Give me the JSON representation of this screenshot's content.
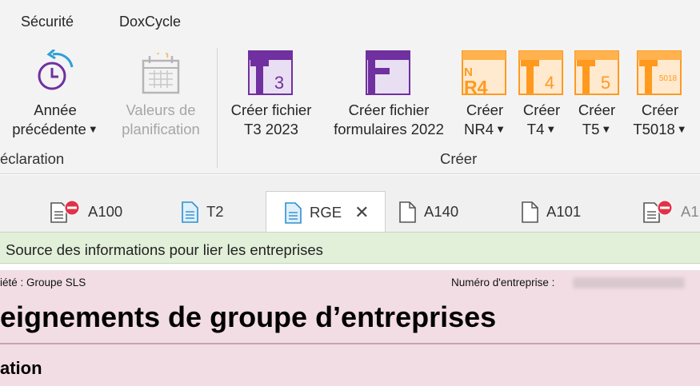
{
  "menu": {
    "tabs": [
      "Sécurité",
      "DoxCycle"
    ]
  },
  "ribbon": {
    "annee": {
      "line1": "Année",
      "line2": "précédente"
    },
    "valeurs": {
      "line1": "Valeurs de",
      "line2": "planification"
    },
    "t3": {
      "icon_text": "T3",
      "line1": "Créer fichier",
      "line2": "T3 2023"
    },
    "form": {
      "icon_text": "F",
      "line1": "Créer fichier",
      "line2": "formulaires 2022"
    },
    "nr4": {
      "icon_text": "NR4",
      "line1": "Créer",
      "line2": "NR4"
    },
    "t4": {
      "icon_text": "T4",
      "line1": "Créer",
      "line2": "T4"
    },
    "t5": {
      "icon_text": "T5",
      "line1": "Créer",
      "line2": "T5"
    },
    "t5018": {
      "icon_text": "T5018",
      "line1": "Créer",
      "line2": "T5018"
    },
    "groups": {
      "declaration": "éclaration",
      "creer": "Créer"
    },
    "colors": {
      "purple": "#7030a0",
      "orange": "#ff9a1f"
    }
  },
  "tabs": [
    {
      "label": "A100"
    },
    {
      "label": "T2"
    },
    {
      "label": "RGE"
    },
    {
      "label": "A140"
    },
    {
      "label": "A101"
    },
    {
      "label": "A1"
    }
  ],
  "info_bar": {
    "text": "Source des informations pour lier les entreprises"
  },
  "form": {
    "company_label": "iété : Groupe SLS",
    "number_label": "Numéro d'entreprise :",
    "title": "eignements de groupe d’entreprises",
    "section": "ation"
  }
}
